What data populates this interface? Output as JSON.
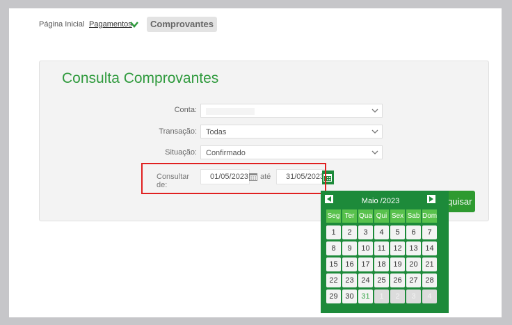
{
  "breadcrumb": {
    "home": "Página Inicial",
    "payments": "Pagamentos",
    "current": "Comprovantes"
  },
  "panel": {
    "title": "Consulta Comprovantes"
  },
  "form": {
    "account_label": "Conta:",
    "account_value": "",
    "transaction_label": "Transação:",
    "transaction_value": "Todas",
    "status_label": "Situação:",
    "status_value": "Confirmado",
    "consult_label_1": "Consultar",
    "consult_label_2": "de:",
    "date_from": "01/05/2023",
    "to_label": "até",
    "date_to": "31/05/2023",
    "search_button_partial": "quisar"
  },
  "calendar": {
    "title": "Maio /2023",
    "weekdays": [
      "Seg",
      "Ter",
      "Qua",
      "Qui",
      "Sex",
      "Sab",
      "Dom"
    ],
    "weeks": [
      [
        "1",
        "2",
        "3",
        "4",
        "5",
        "6",
        "7"
      ],
      [
        "8",
        "9",
        "10",
        "11",
        "12",
        "13",
        "14"
      ],
      [
        "15",
        "16",
        "17",
        "18",
        "19",
        "20",
        "21"
      ],
      [
        "22",
        "23",
        "24",
        "25",
        "26",
        "27",
        "28"
      ],
      [
        "29",
        "30",
        "31",
        "1",
        "2",
        "3",
        "4"
      ]
    ],
    "highlighted_day": "31"
  },
  "colors": {
    "brand_green": "#2f9a3d",
    "calendar_green": "#1d8a3a",
    "header_green": "#58c14c",
    "highlight_red": "#e02020"
  }
}
